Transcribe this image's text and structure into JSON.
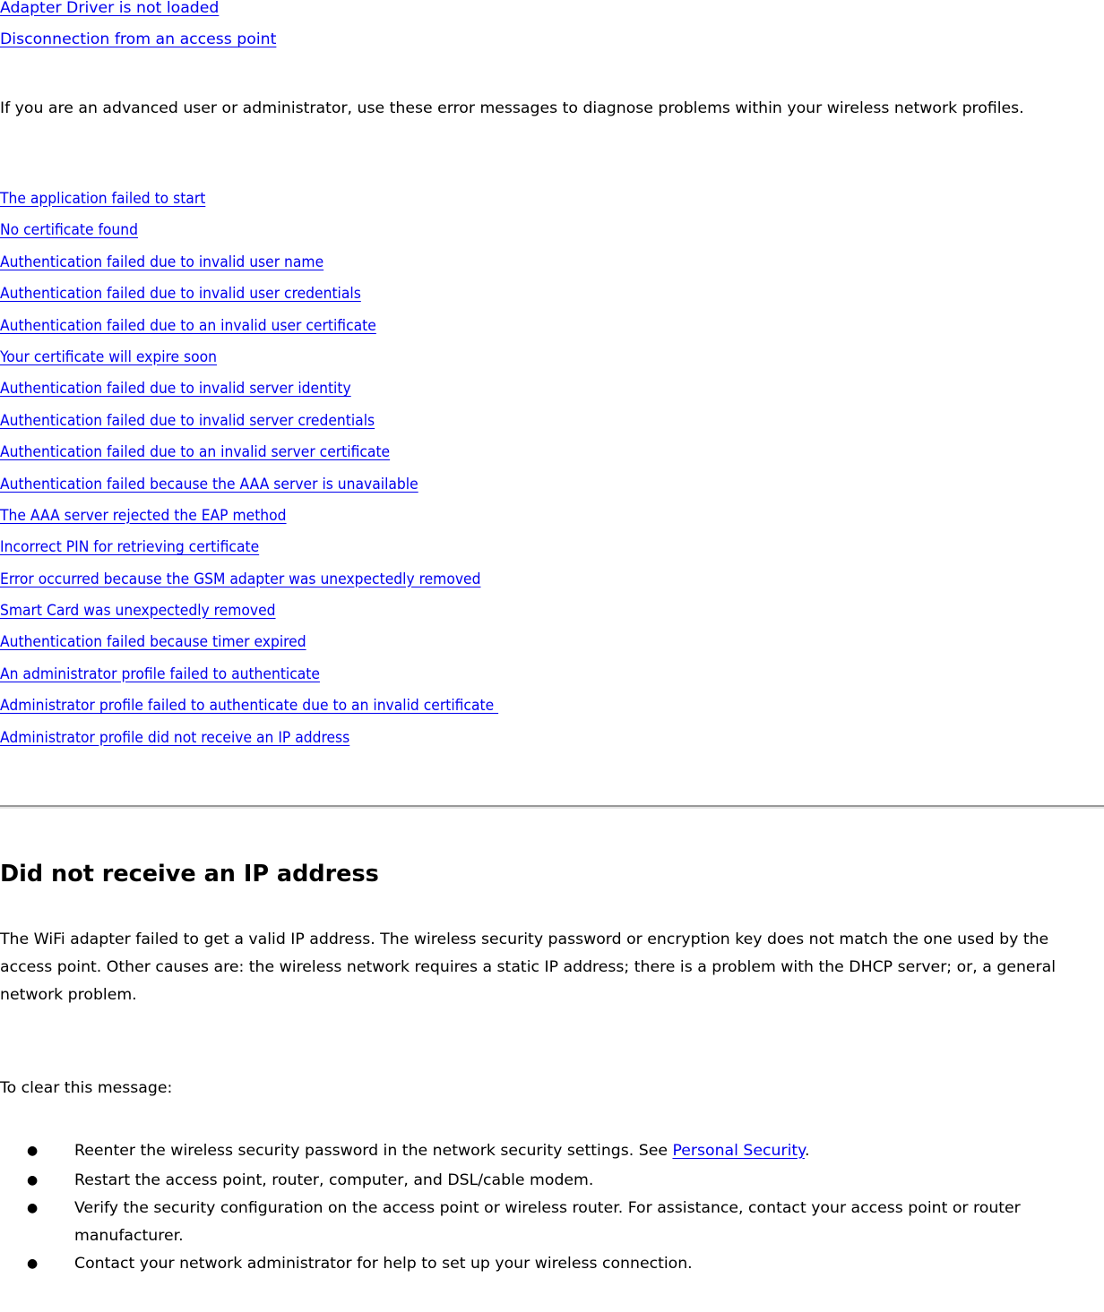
{
  "top_links": [
    "Adapter Driver is not loaded",
    "Disconnection from an access point"
  ],
  "intro_text": "If you are an advanced user or administrator, use these error messages to diagnose problems within your wireless network profiles.",
  "error_links": [
    "The application failed to start",
    "No certificate found",
    "Authentication failed due to invalid user name",
    "Authentication failed due to invalid user credentials",
    "Authentication failed due to an invalid user certificate",
    "Your certificate will expire soon",
    "Authentication failed due to invalid server identity",
    "Authentication failed due to invalid server credentials",
    "Authentication failed due to an invalid server certificate",
    "Authentication failed because the AAA server is unavailable",
    "The AAA server rejected the EAP method",
    "Incorrect PIN for retrieving certificate",
    "Error occurred because the GSM adapter was unexpectedly removed",
    "Smart Card was unexpectedly removed",
    "Authentication failed because timer expired",
    "An administrator profile failed to authenticate",
    "Administrator profile failed to authenticate due to an invalid certificate ",
    "Administrator profile did not receive an IP address"
  ],
  "section": {
    "title": "Did not receive an IP address",
    "description": "The WiFi adapter failed to get a valid IP address. The wireless security password or encryption key does not match the one used by the access point. Other causes are: the wireless network requires a static IP address; there is a problem with the DHCP server; or, a general network problem.",
    "clear_label": "To clear this message:",
    "steps": [
      {
        "text_before": "Reenter the wireless security password in the network security settings. See ",
        "link": "Personal Security",
        "text_after": "."
      },
      {
        "text": "Restart the access point, router, computer, and DSL/cable modem."
      },
      {
        "text": "Verify the security configuration on the access point or wireless router. For assistance, contact your access point or router manufacturer."
      },
      {
        "text": "Contact your network administrator for help to set up your wireless connection."
      }
    ],
    "bullet_glyph": "●"
  },
  "colors": {
    "link": "#0000ee",
    "text": "#000000",
    "divider": "#999999"
  }
}
